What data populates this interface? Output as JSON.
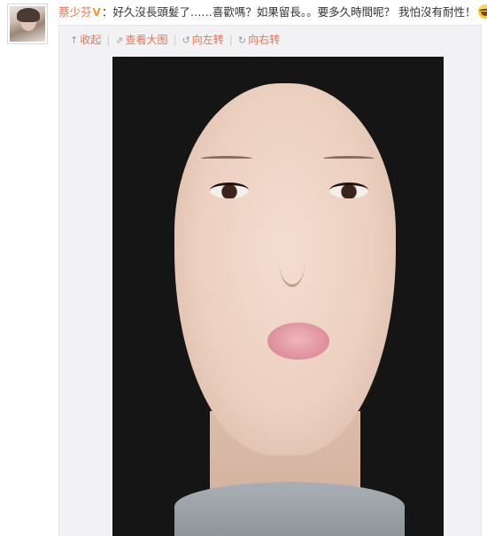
{
  "post": {
    "username": "蔡少芬",
    "verified_badge": "V",
    "separator": "：",
    "text": "好久沒長頭髮了……喜歡嗎？如果留長。。要多久時間呢？ 我怕沒有耐性！",
    "emoji": "laughing-tears-emoji"
  },
  "toolbar": {
    "collapse_label": "收起",
    "view_large_label": "查看大图",
    "rotate_left_label": "向左转",
    "rotate_right_label": "向右转"
  },
  "colors": {
    "link": "#eb7350",
    "badge": "#f39a1e",
    "media_box_bg": "#f2f2f5"
  }
}
